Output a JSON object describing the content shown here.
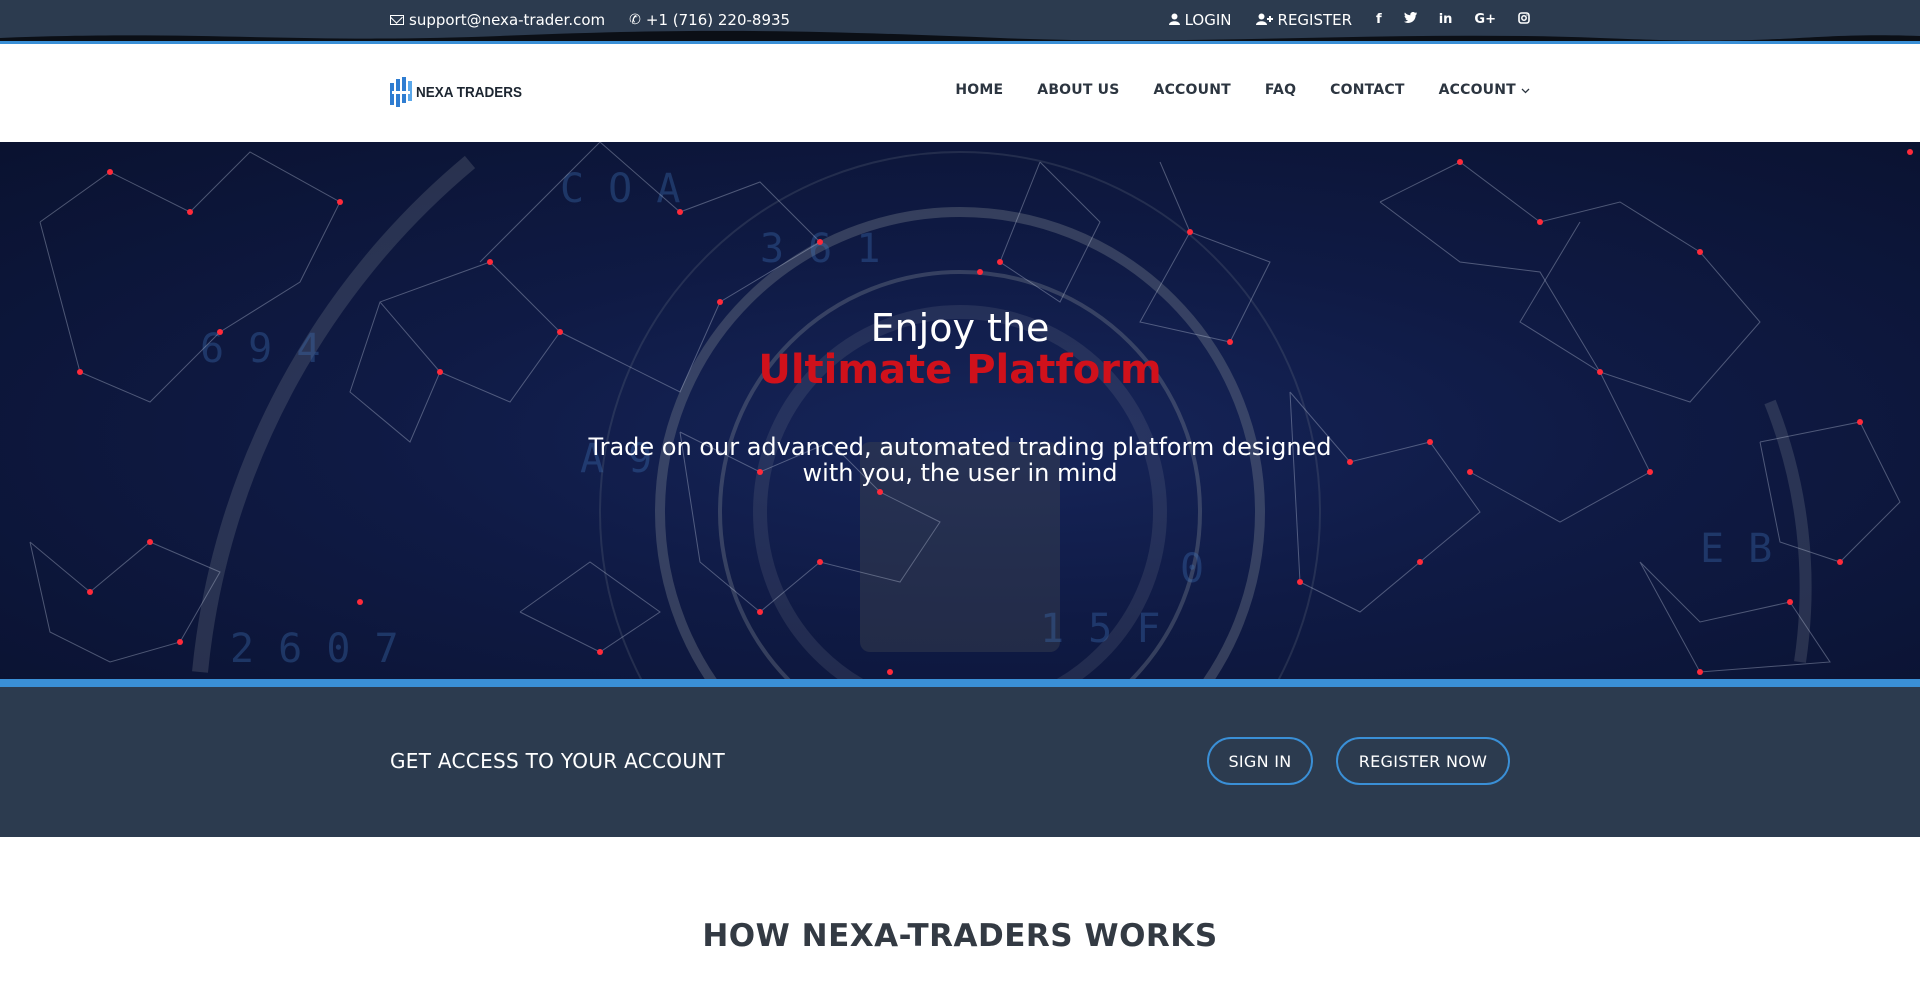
{
  "topbar": {
    "email": "support@nexa-trader.com",
    "phone": "+1 (716) 220-8935",
    "login_label": "LOGIN",
    "register_label": "REGISTER",
    "social": [
      "f",
      "twitter",
      "in",
      "G+",
      "instagram"
    ]
  },
  "header": {
    "logo_text": "NEXA TRADERS",
    "nav": [
      "HOME",
      "ABOUT US",
      "ACCOUNT",
      "FAQ",
      "CONTACT",
      "ACCOUNT"
    ]
  },
  "hero": {
    "title": "Enjoy the",
    "accent": "Ultimate Platform",
    "subtitle_line1": "Trade on our advanced, automated trading platform designed",
    "subtitle_line2": "with you, the user in mind"
  },
  "access": {
    "title": "GET ACCESS TO YOUR ACCOUNT",
    "signin_label": "SIGN IN",
    "register_label": "REGISTER NOW"
  },
  "how": {
    "title": "HOW NEXA-TRADERS WORKS"
  },
  "colors": {
    "topbar_bg": "#2c3b4f",
    "accent_blue": "#3a8fd6",
    "accent_red": "#d0111b",
    "hero_bg": "#0f1a44"
  }
}
